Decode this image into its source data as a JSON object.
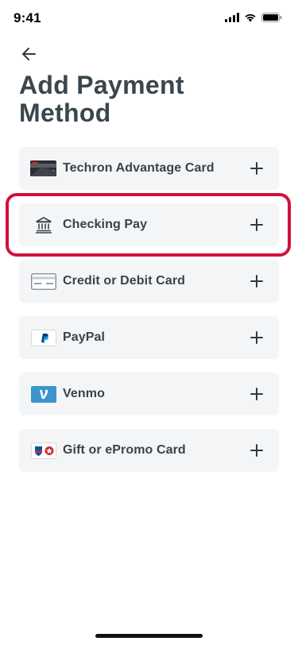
{
  "status": {
    "time": "9:41"
  },
  "header": {
    "title": "Add Payment Method"
  },
  "methods": [
    {
      "label": "Techron Advantage Card",
      "icon": "techron-card-icon"
    },
    {
      "label": "Checking Pay",
      "icon": "bank-icon",
      "highlighted": true
    },
    {
      "label": "Credit or Debit Card",
      "icon": "credit-card-icon"
    },
    {
      "label": "PayPal",
      "icon": "paypal-icon"
    },
    {
      "label": "Venmo",
      "icon": "venmo-icon"
    },
    {
      "label": "Gift or ePromo Card",
      "icon": "gift-card-icon"
    }
  ],
  "colors": {
    "highlight": "#d0123b",
    "item_bg": "#f4f5f6",
    "text": "#38434a",
    "venmo": "#3d95ce",
    "paypal": "#003087"
  }
}
